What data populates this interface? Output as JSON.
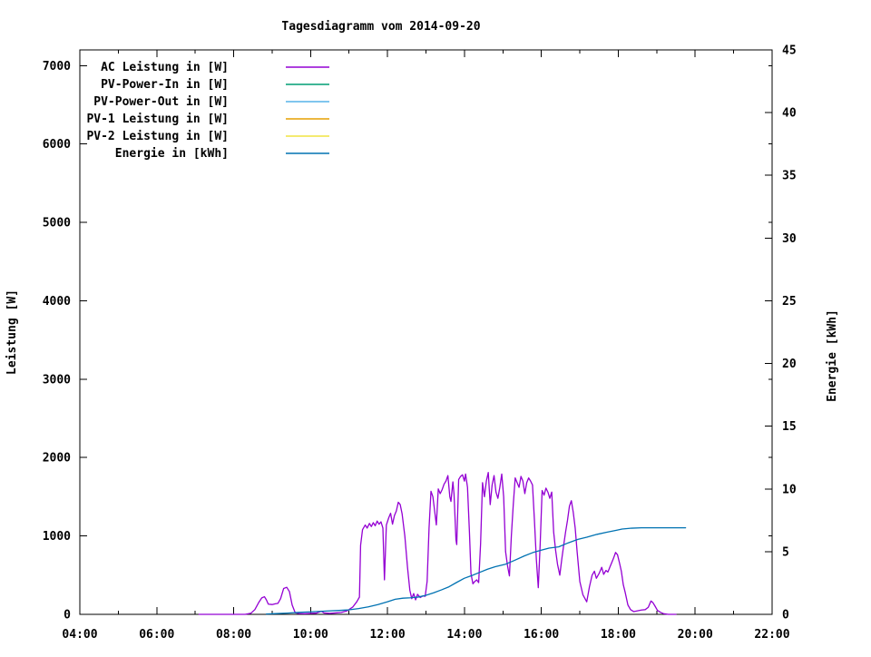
{
  "chart_data": {
    "type": "line",
    "title": "Tagesdiagramm vom 2014-09-20",
    "background_color": "#ffffff",
    "grid": false,
    "legend_position": "top-left-inside",
    "x_axis": {
      "start_hour": 4,
      "end_hour": 22,
      "major_ticks": [
        {
          "hour": 4,
          "label": "04:00"
        },
        {
          "hour": 6,
          "label": "06:00"
        },
        {
          "hour": 8,
          "label": "08:00"
        },
        {
          "hour": 10,
          "label": "10:00"
        },
        {
          "hour": 12,
          "label": "12:00"
        },
        {
          "hour": 14,
          "label": "14:00"
        },
        {
          "hour": 16,
          "label": "16:00"
        },
        {
          "hour": 18,
          "label": "18:00"
        },
        {
          "hour": 20,
          "label": "20:00"
        },
        {
          "hour": 22,
          "label": "22:00"
        }
      ],
      "minor_tick_hours": [
        5,
        7,
        9,
        11,
        13,
        15,
        17,
        19,
        21
      ]
    },
    "y_axis": {
      "label": "Leistung [W]",
      "min": 0,
      "max": 7200,
      "ticks": [
        0,
        1000,
        2000,
        3000,
        4000,
        5000,
        6000,
        7000
      ]
    },
    "y2_axis": {
      "label": "Energie [kWh]",
      "min": 0,
      "max": 45,
      "ticks": [
        0,
        5,
        10,
        15,
        20,
        25,
        30,
        35,
        40,
        45
      ]
    },
    "legend": [
      {
        "label": "AC Leistung in [W]",
        "color": "#9400d3"
      },
      {
        "label": "PV-Power-In in [W]",
        "color": "#009e73"
      },
      {
        "label": "PV-Power-Out in [W]",
        "color": "#56b4e9"
      },
      {
        "label": "PV-1 Leistung in [W]",
        "color": "#e69f00"
      },
      {
        "label": "PV-2 Leistung in [W]",
        "color": "#f0e442"
      },
      {
        "label": "Energie in [kWh]",
        "color": "#0072b2"
      }
    ],
    "series": [
      {
        "name": "AC Leistung in [W]",
        "axis": "y",
        "color": "#9400d3",
        "points": [
          [
            7.1,
            0
          ],
          [
            7.5,
            0
          ],
          [
            8.0,
            0
          ],
          [
            8.3,
            0
          ],
          [
            8.45,
            15
          ],
          [
            8.55,
            60
          ],
          [
            8.65,
            150
          ],
          [
            8.73,
            210
          ],
          [
            8.8,
            225
          ],
          [
            8.85,
            185
          ],
          [
            8.9,
            130
          ],
          [
            9.0,
            125
          ],
          [
            9.08,
            135
          ],
          [
            9.15,
            140
          ],
          [
            9.22,
            200
          ],
          [
            9.3,
            330
          ],
          [
            9.38,
            345
          ],
          [
            9.45,
            290
          ],
          [
            9.52,
            120
          ],
          [
            9.6,
            20
          ],
          [
            9.7,
            10
          ],
          [
            9.85,
            8
          ],
          [
            10.0,
            12
          ],
          [
            10.15,
            15
          ],
          [
            10.28,
            40
          ],
          [
            10.35,
            18
          ],
          [
            10.5,
            12
          ],
          [
            10.65,
            18
          ],
          [
            10.8,
            25
          ],
          [
            10.95,
            45
          ],
          [
            11.1,
            95
          ],
          [
            11.2,
            160
          ],
          [
            11.27,
            220
          ],
          [
            11.3,
            880
          ],
          [
            11.35,
            1080
          ],
          [
            11.42,
            1140
          ],
          [
            11.47,
            1100
          ],
          [
            11.53,
            1160
          ],
          [
            11.58,
            1120
          ],
          [
            11.63,
            1170
          ],
          [
            11.68,
            1130
          ],
          [
            11.73,
            1190
          ],
          [
            11.78,
            1150
          ],
          [
            11.83,
            1180
          ],
          [
            11.88,
            1100
          ],
          [
            11.92,
            440
          ],
          [
            11.97,
            1140
          ],
          [
            12.03,
            1230
          ],
          [
            12.08,
            1290
          ],
          [
            12.13,
            1150
          ],
          [
            12.18,
            1260
          ],
          [
            12.23,
            1320
          ],
          [
            12.28,
            1430
          ],
          [
            12.33,
            1400
          ],
          [
            12.38,
            1280
          ],
          [
            12.45,
            1000
          ],
          [
            12.52,
            600
          ],
          [
            12.58,
            310
          ],
          [
            12.63,
            200
          ],
          [
            12.68,
            265
          ],
          [
            12.73,
            185
          ],
          [
            12.78,
            255
          ],
          [
            12.85,
            215
          ],
          [
            12.92,
            235
          ],
          [
            12.98,
            230
          ],
          [
            13.03,
            420
          ],
          [
            13.08,
            1100
          ],
          [
            13.13,
            1570
          ],
          [
            13.18,
            1500
          ],
          [
            13.23,
            1300
          ],
          [
            13.27,
            1140
          ],
          [
            13.32,
            1600
          ],
          [
            13.37,
            1540
          ],
          [
            13.42,
            1590
          ],
          [
            13.47,
            1660
          ],
          [
            13.52,
            1700
          ],
          [
            13.57,
            1770
          ],
          [
            13.62,
            1500
          ],
          [
            13.65,
            1440
          ],
          [
            13.7,
            1690
          ],
          [
            13.73,
            1530
          ],
          [
            13.78,
            950
          ],
          [
            13.8,
            890
          ],
          [
            13.85,
            1720
          ],
          [
            13.9,
            1760
          ],
          [
            13.95,
            1780
          ],
          [
            14.0,
            1700
          ],
          [
            14.03,
            1790
          ],
          [
            14.08,
            1620
          ],
          [
            14.13,
            1050
          ],
          [
            14.17,
            520
          ],
          [
            14.22,
            390
          ],
          [
            14.27,
            420
          ],
          [
            14.32,
            440
          ],
          [
            14.37,
            405
          ],
          [
            14.42,
            900
          ],
          [
            14.47,
            1680
          ],
          [
            14.52,
            1500
          ],
          [
            14.57,
            1700
          ],
          [
            14.62,
            1810
          ],
          [
            14.67,
            1400
          ],
          [
            14.72,
            1650
          ],
          [
            14.77,
            1770
          ],
          [
            14.82,
            1560
          ],
          [
            14.87,
            1480
          ],
          [
            14.92,
            1620
          ],
          [
            14.97,
            1790
          ],
          [
            15.02,
            1500
          ],
          [
            15.07,
            800
          ],
          [
            15.12,
            620
          ],
          [
            15.17,
            490
          ],
          [
            15.22,
            1000
          ],
          [
            15.27,
            1400
          ],
          [
            15.32,
            1740
          ],
          [
            15.37,
            1680
          ],
          [
            15.42,
            1620
          ],
          [
            15.47,
            1760
          ],
          [
            15.52,
            1700
          ],
          [
            15.57,
            1540
          ],
          [
            15.62,
            1680
          ],
          [
            15.67,
            1740
          ],
          [
            15.72,
            1700
          ],
          [
            15.77,
            1650
          ],
          [
            15.82,
            1200
          ],
          [
            15.87,
            700
          ],
          [
            15.92,
            340
          ],
          [
            15.97,
            900
          ],
          [
            16.02,
            1580
          ],
          [
            16.07,
            1520
          ],
          [
            16.12,
            1610
          ],
          [
            16.17,
            1560
          ],
          [
            16.22,
            1480
          ],
          [
            16.27,
            1560
          ],
          [
            16.32,
            1050
          ],
          [
            16.37,
            820
          ],
          [
            16.42,
            640
          ],
          [
            16.48,
            500
          ],
          [
            16.53,
            700
          ],
          [
            16.58,
            880
          ],
          [
            16.63,
            1050
          ],
          [
            16.68,
            1200
          ],
          [
            16.73,
            1380
          ],
          [
            16.78,
            1450
          ],
          [
            16.83,
            1300
          ],
          [
            16.88,
            1100
          ],
          [
            16.93,
            800
          ],
          [
            17.0,
            420
          ],
          [
            17.08,
            250
          ],
          [
            17.18,
            160
          ],
          [
            17.25,
            350
          ],
          [
            17.32,
            500
          ],
          [
            17.38,
            550
          ],
          [
            17.43,
            460
          ],
          [
            17.5,
            520
          ],
          [
            17.57,
            600
          ],
          [
            17.62,
            510
          ],
          [
            17.68,
            560
          ],
          [
            17.73,
            540
          ],
          [
            17.78,
            600
          ],
          [
            17.83,
            660
          ],
          [
            17.88,
            720
          ],
          [
            17.93,
            790
          ],
          [
            17.98,
            760
          ],
          [
            18.03,
            660
          ],
          [
            18.08,
            550
          ],
          [
            18.13,
            380
          ],
          [
            18.18,
            280
          ],
          [
            18.25,
            120
          ],
          [
            18.32,
            60
          ],
          [
            18.4,
            35
          ],
          [
            18.5,
            45
          ],
          [
            18.6,
            55
          ],
          [
            18.7,
            60
          ],
          [
            18.78,
            90
          ],
          [
            18.85,
            170
          ],
          [
            18.9,
            150
          ],
          [
            18.95,
            110
          ],
          [
            19.02,
            50
          ],
          [
            19.1,
            25
          ],
          [
            19.18,
            8
          ],
          [
            19.3,
            0
          ],
          [
            19.5,
            0
          ]
        ]
      },
      {
        "name": "Energie in [kWh]",
        "axis": "y2",
        "color": "#0072b2",
        "points": [
          [
            8.85,
            0.03
          ],
          [
            9.1,
            0.06
          ],
          [
            9.4,
            0.1
          ],
          [
            9.7,
            0.16
          ],
          [
            10.0,
            0.2
          ],
          [
            10.4,
            0.26
          ],
          [
            10.8,
            0.32
          ],
          [
            11.0,
            0.36
          ],
          [
            11.25,
            0.46
          ],
          [
            11.5,
            0.6
          ],
          [
            11.75,
            0.78
          ],
          [
            12.0,
            1.0
          ],
          [
            12.2,
            1.2
          ],
          [
            12.4,
            1.29
          ],
          [
            12.6,
            1.32
          ],
          [
            12.8,
            1.38
          ],
          [
            13.0,
            1.52
          ],
          [
            13.2,
            1.72
          ],
          [
            13.4,
            1.95
          ],
          [
            13.6,
            2.2
          ],
          [
            13.8,
            2.55
          ],
          [
            14.0,
            2.88
          ],
          [
            14.2,
            3.1
          ],
          [
            14.4,
            3.35
          ],
          [
            14.6,
            3.6
          ],
          [
            14.8,
            3.8
          ],
          [
            15.07,
            4.0
          ],
          [
            15.3,
            4.3
          ],
          [
            15.55,
            4.65
          ],
          [
            15.8,
            4.95
          ],
          [
            16.0,
            5.12
          ],
          [
            16.2,
            5.28
          ],
          [
            16.45,
            5.38
          ],
          [
            16.7,
            5.7
          ],
          [
            16.95,
            5.98
          ],
          [
            17.18,
            6.15
          ],
          [
            17.45,
            6.38
          ],
          [
            17.7,
            6.55
          ],
          [
            17.95,
            6.7
          ],
          [
            18.1,
            6.8
          ],
          [
            18.35,
            6.87
          ],
          [
            18.6,
            6.9
          ],
          [
            19.0,
            6.9
          ],
          [
            19.45,
            6.9
          ],
          [
            19.75,
            6.9
          ]
        ]
      }
    ]
  }
}
